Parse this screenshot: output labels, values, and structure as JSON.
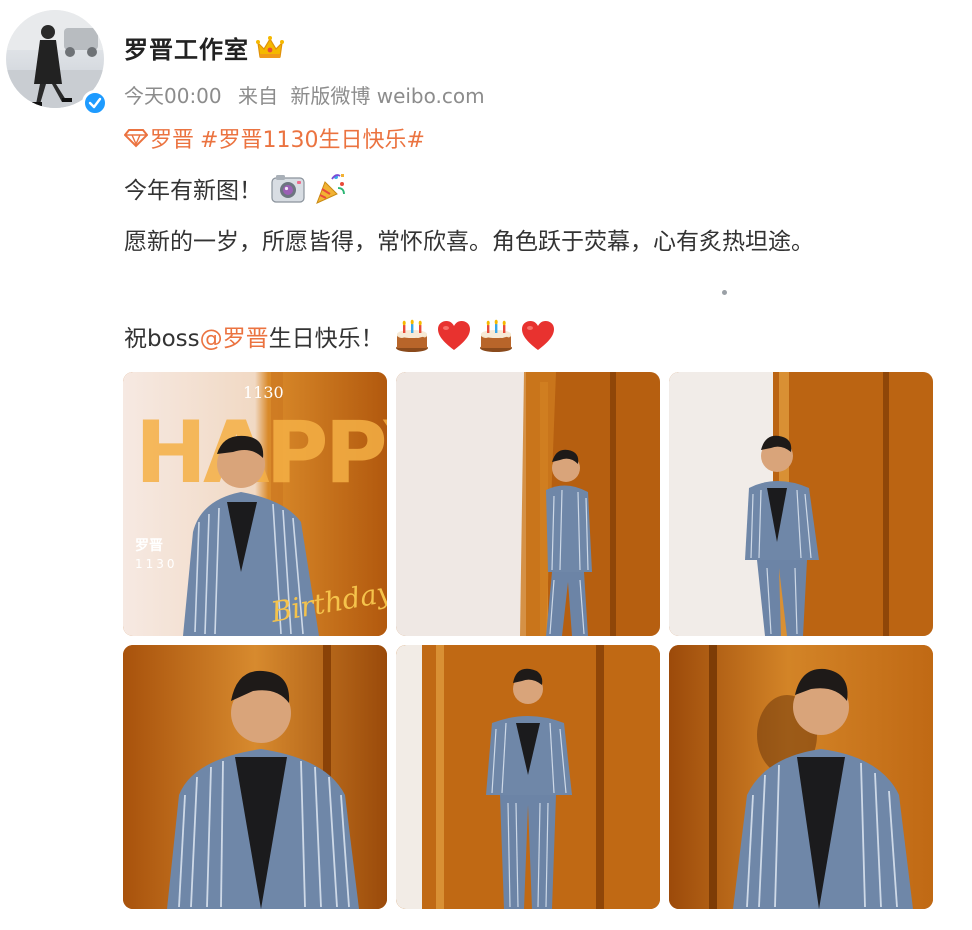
{
  "post": {
    "author": "罗晋工作室",
    "timestamp": "今天00:00",
    "source_prefix": "来自",
    "source_name": "新版微博 weibo.com",
    "supertopic": "罗晋",
    "hashtag": "#罗晋1130生日快乐#",
    "line1": "今年有新图！",
    "line2": "愿新的一岁，所愿皆得，常怀欣喜。角色跃于荧幕，心有炙热坦途。",
    "line3_prefix": "祝boss",
    "mention": "@罗晋",
    "line3_suffix": " 生日快乐！"
  },
  "icons": {
    "crown": "crown-icon",
    "verified": "verified-check-icon",
    "supertopic": "diamond-gem-icon",
    "camera": "camera-emoji",
    "party": "party-popper-emoji",
    "cake": "birthday-cake-emoji",
    "heart": "red-heart-emoji"
  },
  "photos": {
    "cover_number": "1130",
    "cover_big_text": "HAPPY",
    "cover_name": "罗晋",
    "cover_name_number": "1130",
    "cover_script": "Birthday"
  },
  "colors": {
    "link": "#eb7340",
    "meta": "#8c8c8c",
    "verified": "#1e9bff",
    "text": "#333333"
  }
}
